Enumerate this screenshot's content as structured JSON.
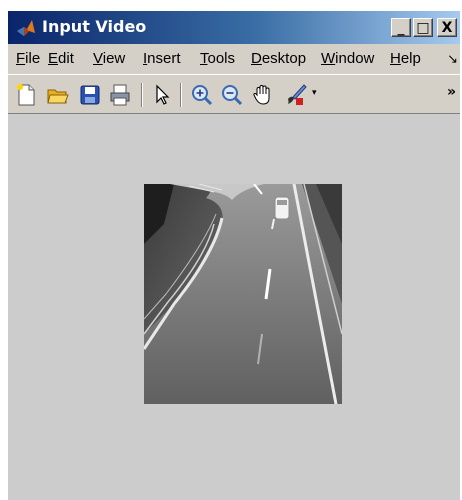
{
  "window": {
    "title": "Input Video",
    "controls": {
      "minimize": "_",
      "maximize": "□",
      "close": "X"
    }
  },
  "menu": {
    "items": [
      {
        "key": "F",
        "rest": "ile"
      },
      {
        "key": "E",
        "rest": "dit"
      },
      {
        "key": "V",
        "rest": "iew"
      },
      {
        "key": "I",
        "rest": "nsert"
      },
      {
        "key": "T",
        "rest": "ools"
      },
      {
        "key": "D",
        "rest": "esktop"
      },
      {
        "key": "W",
        "rest": "indow"
      },
      {
        "key": "H",
        "rest": "elp"
      }
    ],
    "overflow": "↘"
  },
  "toolbar": {
    "icons": [
      "new-figure-icon",
      "open-folder-icon",
      "save-icon",
      "print-icon",
      "pointer-icon",
      "zoom-in-icon",
      "zoom-out-icon",
      "pan-hand-icon",
      "data-brush-icon"
    ],
    "dropdown_glyph": "▾",
    "overflow": "»"
  },
  "figure": {
    "background": "#cccccc",
    "image": "grayscale-highway-frame"
  }
}
